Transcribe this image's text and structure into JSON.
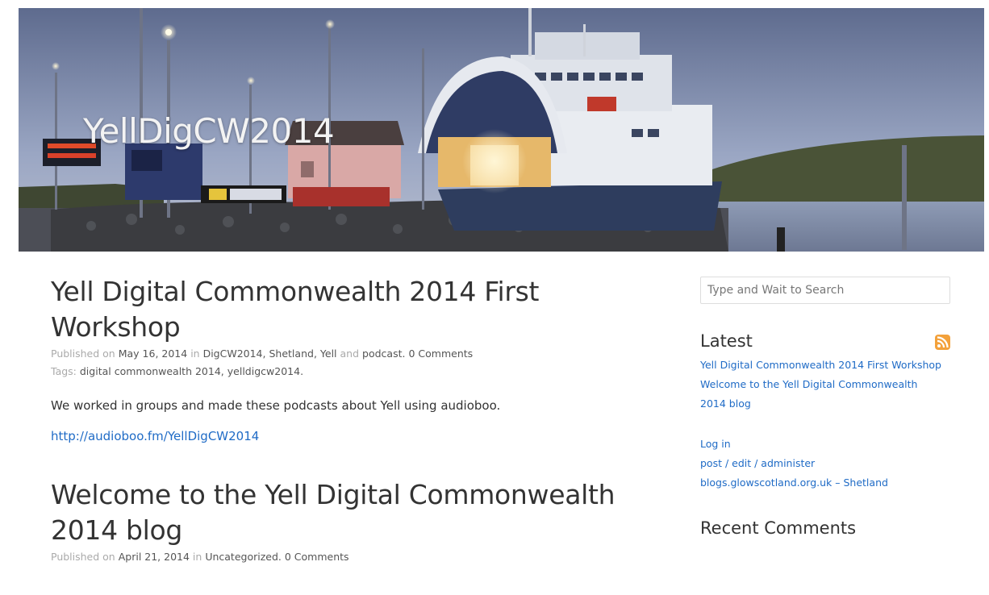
{
  "site": {
    "title": "YellDigCW2014"
  },
  "posts": [
    {
      "title": "Yell Digital Commonwealth 2014 First Workshop",
      "meta_prefix": "Published on",
      "date": "May 16, 2014",
      "in_word": "in",
      "categories": [
        "DigCW2014",
        "Shetland",
        "Yell"
      ],
      "and_word": "and",
      "last_category": "podcast",
      "comments": "0 Comments",
      "tags_label": "Tags:",
      "tags": [
        "digital commonwealth 2014",
        "yelldigcw2014"
      ],
      "excerpt": "We worked in groups and made these podcasts about Yell using audioboo.",
      "link": "http://audioboo.fm/YellDigCW2014"
    },
    {
      "title": "Welcome to the Yell Digital Commonwealth 2014 blog",
      "meta_prefix": "Published on",
      "date": "April 21, 2014",
      "in_word": "in",
      "category": "Uncategorized",
      "comments": "0 Comments"
    }
  ],
  "sidebar": {
    "search_placeholder": "Type and Wait to Search",
    "latest_title": "Latest",
    "rss_icon": "rss-feed-icon",
    "latest_links": [
      "Yell Digital Commonwealth 2014 First Workshop",
      "Welcome to the Yell Digital Commonwealth 2014 blog"
    ],
    "meta_links": [
      "Log in",
      "post / edit / administer",
      "blogs.glowscotland.org.uk – Shetland"
    ],
    "recent_comments_title": "Recent Comments"
  },
  "colors": {
    "link": "#1f6bc6",
    "rss": "#f3a13b",
    "title": "#333333"
  }
}
